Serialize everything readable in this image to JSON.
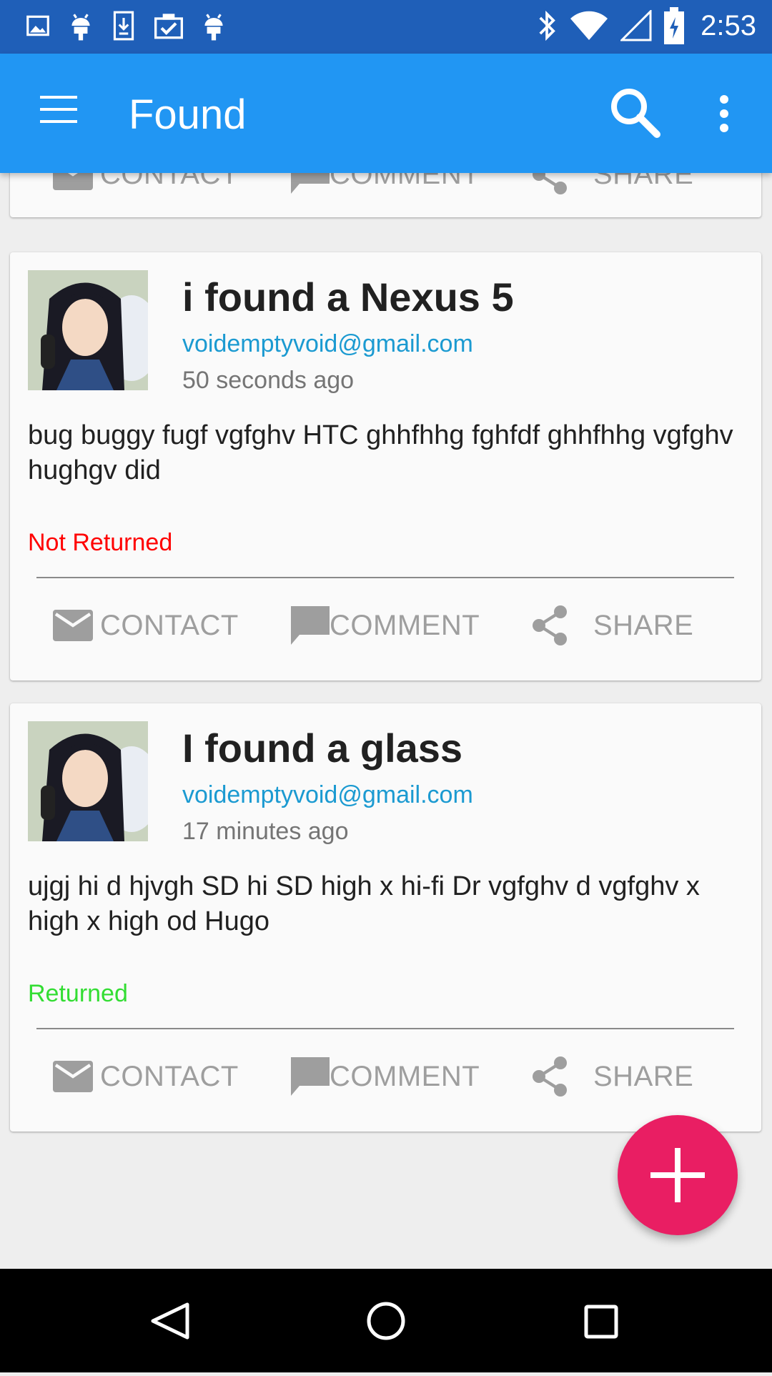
{
  "status_bar": {
    "time": "2:53",
    "left_icons": [
      "image-icon",
      "android-icon",
      "download-icon",
      "clipboard-check-icon",
      "android-icon"
    ],
    "right_icons": [
      "bluetooth-icon",
      "wifi-icon",
      "cell-signal-icon",
      "battery-charging-icon"
    ]
  },
  "app_bar": {
    "title": "Found",
    "color": "#2196f3"
  },
  "actions": {
    "contact": "CONTACT",
    "comment": "COMMENT",
    "share": "SHARE"
  },
  "posts": [
    {
      "title": "i found a Nexus 5",
      "email": "voidemptyvoid@gmail.com",
      "time": "50 seconds ago",
      "body": "bug buggy fugf vgfghv HTC ghhfhhg fghfdf ghhfhhg vgfghv hughgv did",
      "status": "Not Returned",
      "status_color": "#ff0000"
    },
    {
      "title": "I found a glass",
      "email": "voidemptyvoid@gmail.com",
      "time": "17 minutes ago",
      "body": "ujgj hi d hjvgh SD hi SD high x hi-fi Dr vgfghv d vgfghv x high x high od Hugo",
      "status": "Returned",
      "status_color": "#33dd33"
    }
  ],
  "fab": {
    "icon": "plus-icon",
    "color": "#e91e63"
  },
  "nav_bar": {
    "icons": [
      "back-icon",
      "home-icon",
      "recents-icon"
    ]
  }
}
